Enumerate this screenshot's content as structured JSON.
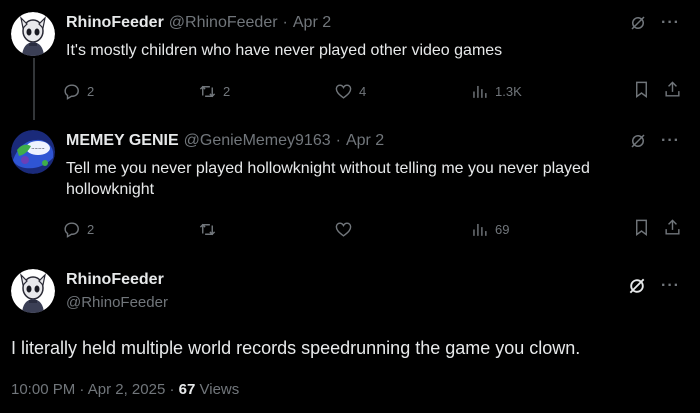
{
  "replies": [
    {
      "display_name": "RhinoFeeder",
      "handle": "@RhinoFeeder",
      "separator": "·",
      "date": "Apr 2",
      "more_label": "···",
      "text": "It's mostly children who have never played other video games",
      "reply_count": "2",
      "retweet_count": "2",
      "like_count": "4",
      "view_count": "1.3K"
    },
    {
      "display_name": "MEMEY GENIE",
      "handle": "@GenieMemey9163",
      "separator": "·",
      "date": "Apr 2",
      "more_label": "···",
      "text": "Tell me you never played hollowknight without telling me you never played hollowknight",
      "reply_count": "2",
      "retweet_count": "",
      "like_count": "",
      "view_count": "69"
    }
  ],
  "main_tweet": {
    "display_name": "RhinoFeeder",
    "handle": "@RhinoFeeder",
    "more_label": "···",
    "text": "I literally held multiple world records speedrunning the game you clown.",
    "time": "10:00 PM",
    "separator": "·",
    "date": "Apr 2, 2025",
    "separator2": "·",
    "views_count": "67",
    "views_label": "Views"
  },
  "colors": {
    "background": "#000000",
    "primary_text": "#e7e9ea",
    "secondary_text": "#71767b",
    "thread_line": "#333639"
  },
  "icons": [
    "reply-icon",
    "retweet-icon",
    "like-icon",
    "views-icon",
    "bookmark-icon",
    "share-icon",
    "grok-icon",
    "more-icon"
  ]
}
